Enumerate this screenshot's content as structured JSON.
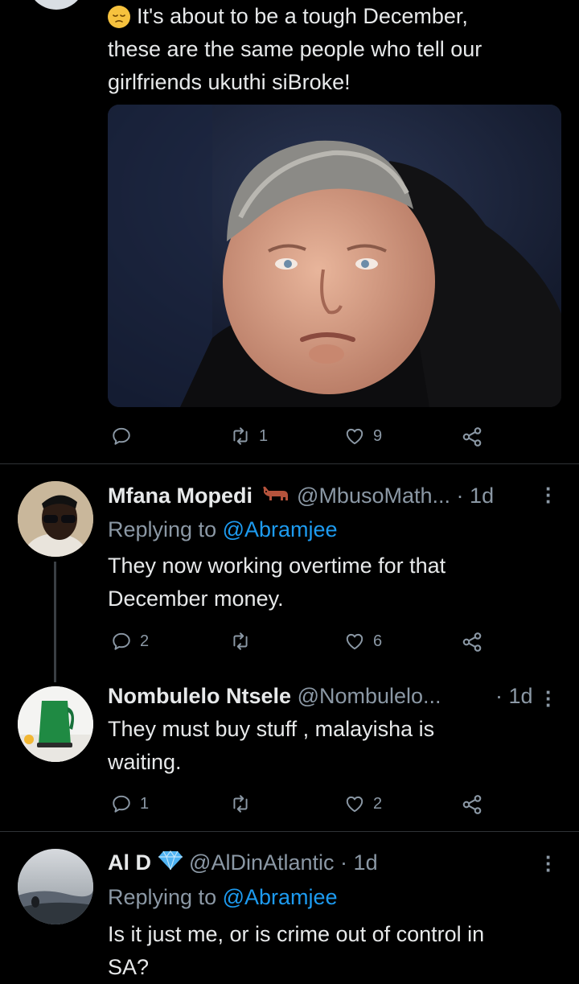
{
  "main_tweet": {
    "emoji": "😔",
    "text_line1": "It's about to be a tough December,",
    "text_line2": "these are the same people who tell our",
    "text_line3": "girlfriends ukuthi siBroke!",
    "retweets": "1",
    "likes": "9"
  },
  "replies": [
    {
      "name": "Mfana Mopedi",
      "handle": "@MbusoMath...",
      "sep": "·",
      "time": "1d",
      "replying_prefix": "Replying to",
      "replying_to": "@Abramjee",
      "text_line1": "They now working overtime for that",
      "text_line2": "December money.",
      "replies": "2",
      "retweets": "",
      "likes": "6"
    },
    {
      "name": "Nombulelo Ntsele",
      "handle": "@Nombulelo...",
      "sep": "·",
      "time": "1d",
      "text_line1": "They must buy stuff , malayisha is",
      "text_line2": "waiting.",
      "replies": "1",
      "retweets": "",
      "likes": "2"
    },
    {
      "name": "Al D",
      "handle": "@AlDinAtlantic",
      "sep": "·",
      "time": "1d",
      "replying_prefix": "Replying to",
      "replying_to": "@Abramjee",
      "text_line1": "Is it just me, or is crime out of control in",
      "text_line2": "SA?"
    }
  ],
  "colors": {
    "background": "#000000",
    "text": "#e7e9ea",
    "secondary": "#8b98a5",
    "link": "#1d9bf0",
    "divider": "#2f3336"
  },
  "icons": [
    "reply-icon",
    "retweet-icon",
    "like-icon",
    "share-icon",
    "more-icon",
    "cow-emoji-icon",
    "diamond-emoji-icon"
  ]
}
